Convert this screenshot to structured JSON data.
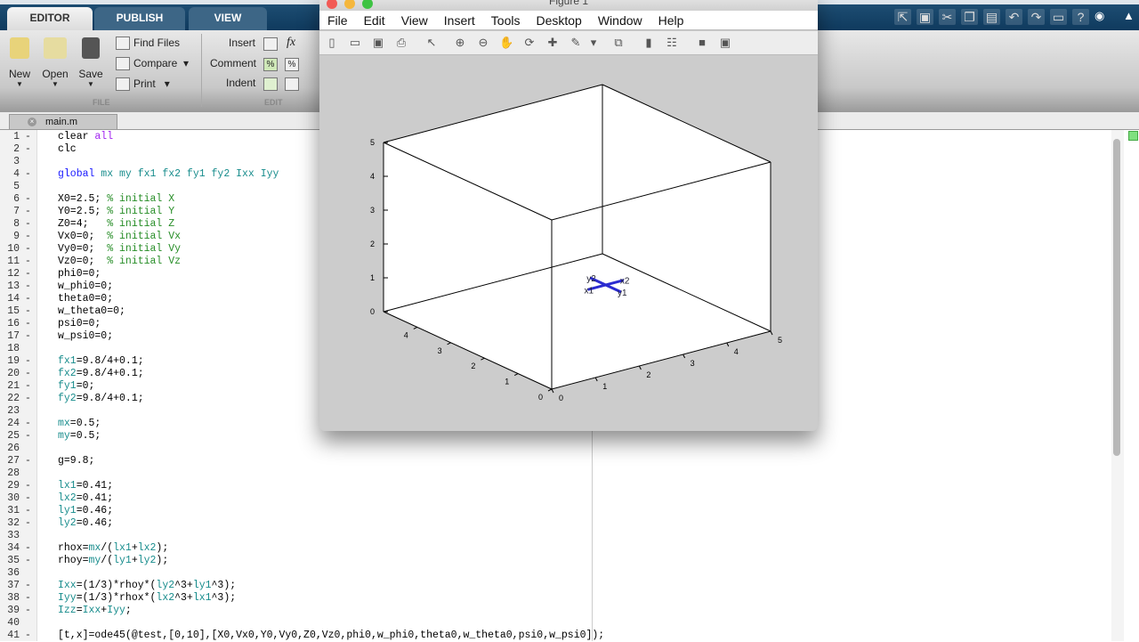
{
  "toolstrip": {
    "tabs": [
      "EDITOR",
      "PUBLISH",
      "VIEW"
    ],
    "active_tab": "EDITOR",
    "quick_icons": [
      "new-shortcut-icon",
      "save-icon",
      "cut-icon",
      "copy-icon",
      "paste-icon",
      "undo-icon",
      "redo-icon",
      "switch-windows-icon",
      "help-icon"
    ]
  },
  "ribbon": {
    "new": "New",
    "open": "Open",
    "save": "Save",
    "find_files": "Find Files",
    "compare": "Compare",
    "print": "Print",
    "file_section": "FILE",
    "insert": "Insert",
    "comment": "Comment",
    "indent": "Indent",
    "edit_section": "EDIT",
    "fx": "fx"
  },
  "editor": {
    "file_tab": "main.m",
    "lines": [
      {
        "n": 1,
        "b": true,
        "t": "clear all"
      },
      {
        "n": 2,
        "b": true,
        "t": "clc"
      },
      {
        "n": 3,
        "b": false,
        "t": ""
      },
      {
        "n": 4,
        "b": true,
        "t": "global mx my fx1 fx2 fy1 fy2 Ixx Iyy"
      },
      {
        "n": 5,
        "b": false,
        "t": ""
      },
      {
        "n": 6,
        "b": true,
        "t": "X0=2.5; % initial X"
      },
      {
        "n": 7,
        "b": true,
        "t": "Y0=2.5; % initial Y"
      },
      {
        "n": 8,
        "b": true,
        "t": "Z0=4;   % initial Z"
      },
      {
        "n": 9,
        "b": true,
        "t": "Vx0=0;  % initial Vx"
      },
      {
        "n": 10,
        "b": true,
        "t": "Vy0=0;  % initial Vy"
      },
      {
        "n": 11,
        "b": true,
        "t": "Vz0=0;  % initial Vz"
      },
      {
        "n": 12,
        "b": true,
        "t": "phi0=0;"
      },
      {
        "n": 13,
        "b": true,
        "t": "w_phi0=0;"
      },
      {
        "n": 14,
        "b": true,
        "t": "theta0=0;"
      },
      {
        "n": 15,
        "b": true,
        "t": "w_theta0=0;"
      },
      {
        "n": 16,
        "b": true,
        "t": "psi0=0;"
      },
      {
        "n": 17,
        "b": true,
        "t": "w_psi0=0;"
      },
      {
        "n": 18,
        "b": false,
        "t": ""
      },
      {
        "n": 19,
        "b": true,
        "t": "fx1=9.8/4+0.1;"
      },
      {
        "n": 20,
        "b": true,
        "t": "fx2=9.8/4+0.1;"
      },
      {
        "n": 21,
        "b": true,
        "t": "fy1=0;"
      },
      {
        "n": 22,
        "b": true,
        "t": "fy2=9.8/4+0.1;"
      },
      {
        "n": 23,
        "b": false,
        "t": ""
      },
      {
        "n": 24,
        "b": true,
        "t": "mx=0.5;"
      },
      {
        "n": 25,
        "b": true,
        "t": "my=0.5;"
      },
      {
        "n": 26,
        "b": false,
        "t": ""
      },
      {
        "n": 27,
        "b": true,
        "t": "g=9.8;"
      },
      {
        "n": 28,
        "b": false,
        "t": ""
      },
      {
        "n": 29,
        "b": true,
        "t": "lx1=0.41;"
      },
      {
        "n": 30,
        "b": true,
        "t": "lx2=0.41;"
      },
      {
        "n": 31,
        "b": true,
        "t": "ly1=0.46;"
      },
      {
        "n": 32,
        "b": true,
        "t": "ly2=0.46;"
      },
      {
        "n": 33,
        "b": false,
        "t": ""
      },
      {
        "n": 34,
        "b": true,
        "t": "rhox=mx/(lx1+lx2);"
      },
      {
        "n": 35,
        "b": true,
        "t": "rhoy=my/(ly1+ly2);"
      },
      {
        "n": 36,
        "b": false,
        "t": ""
      },
      {
        "n": 37,
        "b": true,
        "t": "Ixx=(1/3)*rhoy*(ly2^3+ly1^3);"
      },
      {
        "n": 38,
        "b": true,
        "t": "Iyy=(1/3)*rhox*(lx2^3+lx1^3);"
      },
      {
        "n": 39,
        "b": true,
        "t": "Izz=Ixx+Iyy;"
      },
      {
        "n": 40,
        "b": false,
        "t": ""
      },
      {
        "n": 41,
        "b": true,
        "t": "[t,x]=ode45(@test,[0,10],[X0,Vx0,Y0,Vy0,Z0,Vz0,phi0,w_phi0,theta0,w_theta0,psi0,w_psi0]);"
      }
    ]
  },
  "figure": {
    "title": "Figure 1",
    "menu": [
      "File",
      "Edit",
      "View",
      "Insert",
      "Tools",
      "Desktop",
      "Window",
      "Help"
    ],
    "tools": [
      "new-figure-icon",
      "open-icon",
      "save-icon",
      "print-icon",
      "pointer-icon",
      "zoom-in-icon",
      "zoom-out-icon",
      "pan-icon",
      "rotate-3d-icon",
      "data-cursor-icon",
      "brush-icon",
      "dropdown-icon",
      "link-plot-icon",
      "colorbar-icon",
      "legend-icon",
      "hide-plot-tools-icon",
      "show-plot-tools-icon"
    ]
  },
  "chart_data": {
    "type": "line3d",
    "xlim": [
      0,
      5
    ],
    "ylim": [
      0,
      5
    ],
    "zlim": [
      0,
      5
    ],
    "xticks": [
      0,
      1,
      2,
      3,
      4,
      5
    ],
    "yticks": [
      0,
      1,
      2,
      3,
      4
    ],
    "zticks": [
      0,
      1,
      2,
      3,
      4,
      5
    ],
    "box": true,
    "grid": false,
    "color": "#2b2bd0",
    "series": [
      {
        "points": [
          {
            "label": "x1",
            "x": 2.59,
            "y": 2.3,
            "z": 1
          },
          {
            "label": "x2",
            "x": 3.41,
            "y": 2.3,
            "z": 1
          }
        ]
      },
      {
        "points": [
          {
            "label": "y1",
            "x": 3,
            "y": 1.84,
            "z": 1
          },
          {
            "label": "y2",
            "x": 3,
            "y": 2.76,
            "z": 1
          }
        ]
      }
    ]
  }
}
